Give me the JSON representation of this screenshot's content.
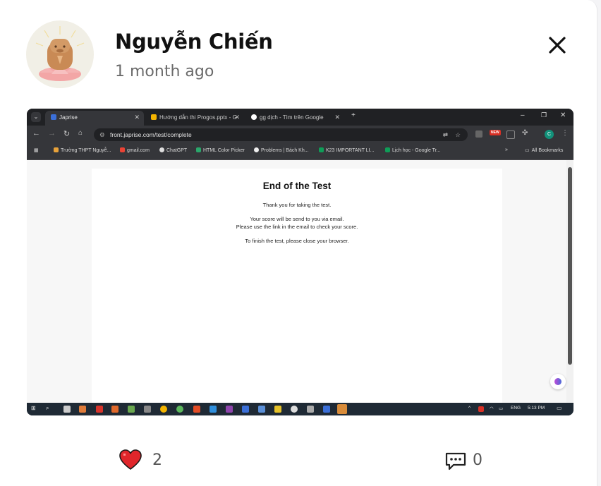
{
  "post": {
    "author_name": "Nguyễn Chiến",
    "timestamp": "1 month ago",
    "likes": "2",
    "comments": "0"
  },
  "browser": {
    "tabs": [
      {
        "label": "Japrise",
        "active": true
      },
      {
        "label": "Hướng dẫn thi Progos.pptx - G",
        "active": false
      },
      {
        "label": "gg dịch - Tìm trên Google",
        "active": false
      }
    ],
    "url": "front.japrise.com/test/complete",
    "profile_initial": "C",
    "new_badge": "NEW",
    "bookmarks": [
      "Trường THPT Nguyễ...",
      "gmail.com",
      "ChatGPT",
      "HTML Color Picker",
      "Problems | Bách Kh...",
      "K23 IMPORTANT LI...",
      "Lịch học - Google Tr..."
    ],
    "all_bookmarks": "All Bookmarks"
  },
  "web_page": {
    "title": "End of the Test",
    "thanks": "Thank you for taking the test.",
    "score_line1": "Your score will be send to you via email.",
    "score_line2": "Please use the link in the email to check your score.",
    "finish": "To finish the test, please close your browser."
  },
  "taskbar": {
    "language": "ENG",
    "clock": "5:13 PM"
  },
  "colors": {
    "heart": "#e0262b",
    "browser_dark": "#202124",
    "taskbar": "#1f2a35"
  }
}
